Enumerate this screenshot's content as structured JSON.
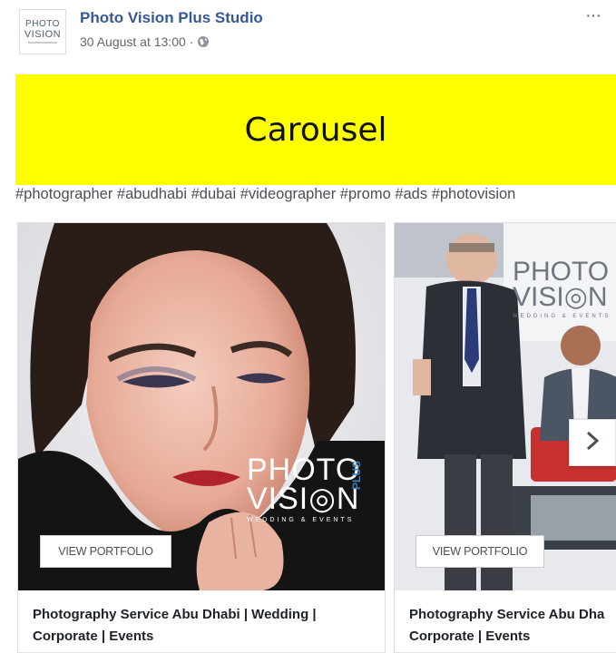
{
  "post": {
    "page_name": "Photo Vision Plus Studio",
    "timestamp": "30 August at 13:00 ·",
    "more_label": "···",
    "avatar": {
      "line1": "PHOTO",
      "line2": "VISION"
    }
  },
  "banner": {
    "text": "Carousel",
    "color": "#ffff00"
  },
  "caption": {
    "hashtags": "#photographer #abudhabi #dubai #videographer #promo #ads #photovision"
  },
  "carousel": {
    "cards": [
      {
        "button_label": "VIEW PORTFOLIO",
        "title": "Photography Service Abu Dhabi | Wedding | Corporate | Events",
        "logo": {
          "line1": "PHOTO",
          "line2": "VISI◎N",
          "plus": "PLUS",
          "tagline": "WEDDING & EVENTS"
        }
      },
      {
        "button_label": "VIEW PORTFOLIO",
        "title_line1": "Photography Service Abu Dha",
        "title_line2": "Corporate | Events",
        "logo": {
          "line1": "PHOTO",
          "line2": "VISI◎N",
          "tagline": "WEDDING & EVENTS"
        }
      }
    ],
    "next_icon": "chevron-right-icon"
  },
  "colors": {
    "link": "#365899",
    "meta": "#616770",
    "text": "#1d2129"
  }
}
